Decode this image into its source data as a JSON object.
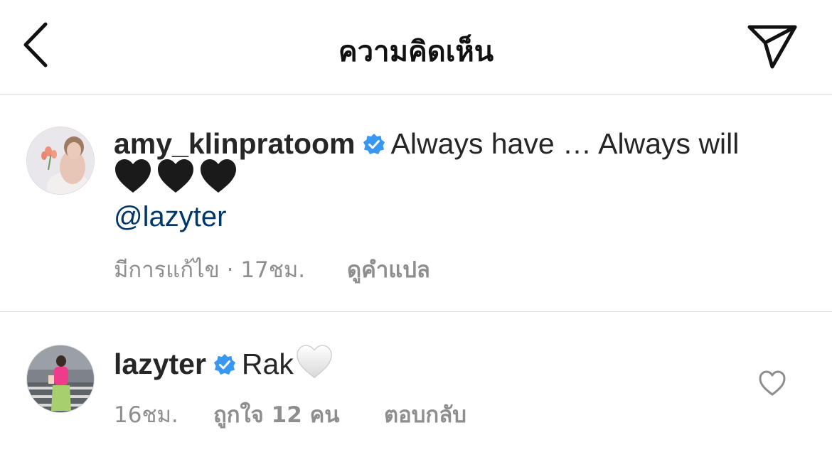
{
  "header": {
    "title": "ความคิดเห็น",
    "back_icon": "chevron-left-icon",
    "share_icon": "paper-plane-icon"
  },
  "comments": [
    {
      "username": "amy_klinpratoom",
      "verified": true,
      "text": "Always have … Always will",
      "emoji": "🖤🖤🖤",
      "mention": "@lazyter",
      "edited": "มีการแก้ไข · 17ชม.",
      "translate": "ดูคำแปล"
    },
    {
      "username": "lazyter",
      "verified": true,
      "text": "Rak",
      "emoji": "🤍",
      "time": "16ชม.",
      "likes": "ถูกใจ 12 คน",
      "reply": "ตอบกลับ"
    }
  ],
  "colors": {
    "verified": "#3897f0",
    "mention": "#00376b",
    "meta": "#8e8e8e",
    "divider": "#dbdbdb"
  }
}
